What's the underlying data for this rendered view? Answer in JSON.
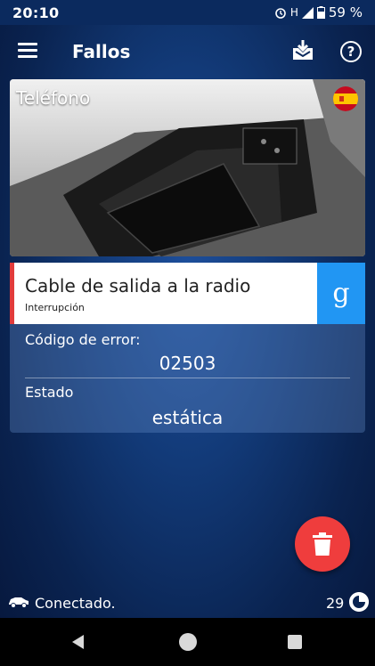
{
  "status_bar": {
    "time": "20:10",
    "network": "H",
    "battery": "59 %"
  },
  "app_bar": {
    "title": "Fallos",
    "menu_icon": "menu-icon",
    "download_icon": "download-icon",
    "help_icon": "help-icon"
  },
  "module": {
    "label": "Teléfono",
    "flag_icon": "spain-flag-icon"
  },
  "fault": {
    "name": "Cable de salida a la radio",
    "subtitle": "Interrupción",
    "google_label": "g",
    "accent_color": "#e23b3b"
  },
  "details": {
    "error_code_label": "Código de error:",
    "error_code_value": "02503",
    "state_label": "Estado",
    "state_value": "estática"
  },
  "fab": {
    "icon": "trash-icon",
    "color": "#ef3d3d"
  },
  "footer": {
    "connection_text": "Conectado.",
    "count": "29"
  }
}
